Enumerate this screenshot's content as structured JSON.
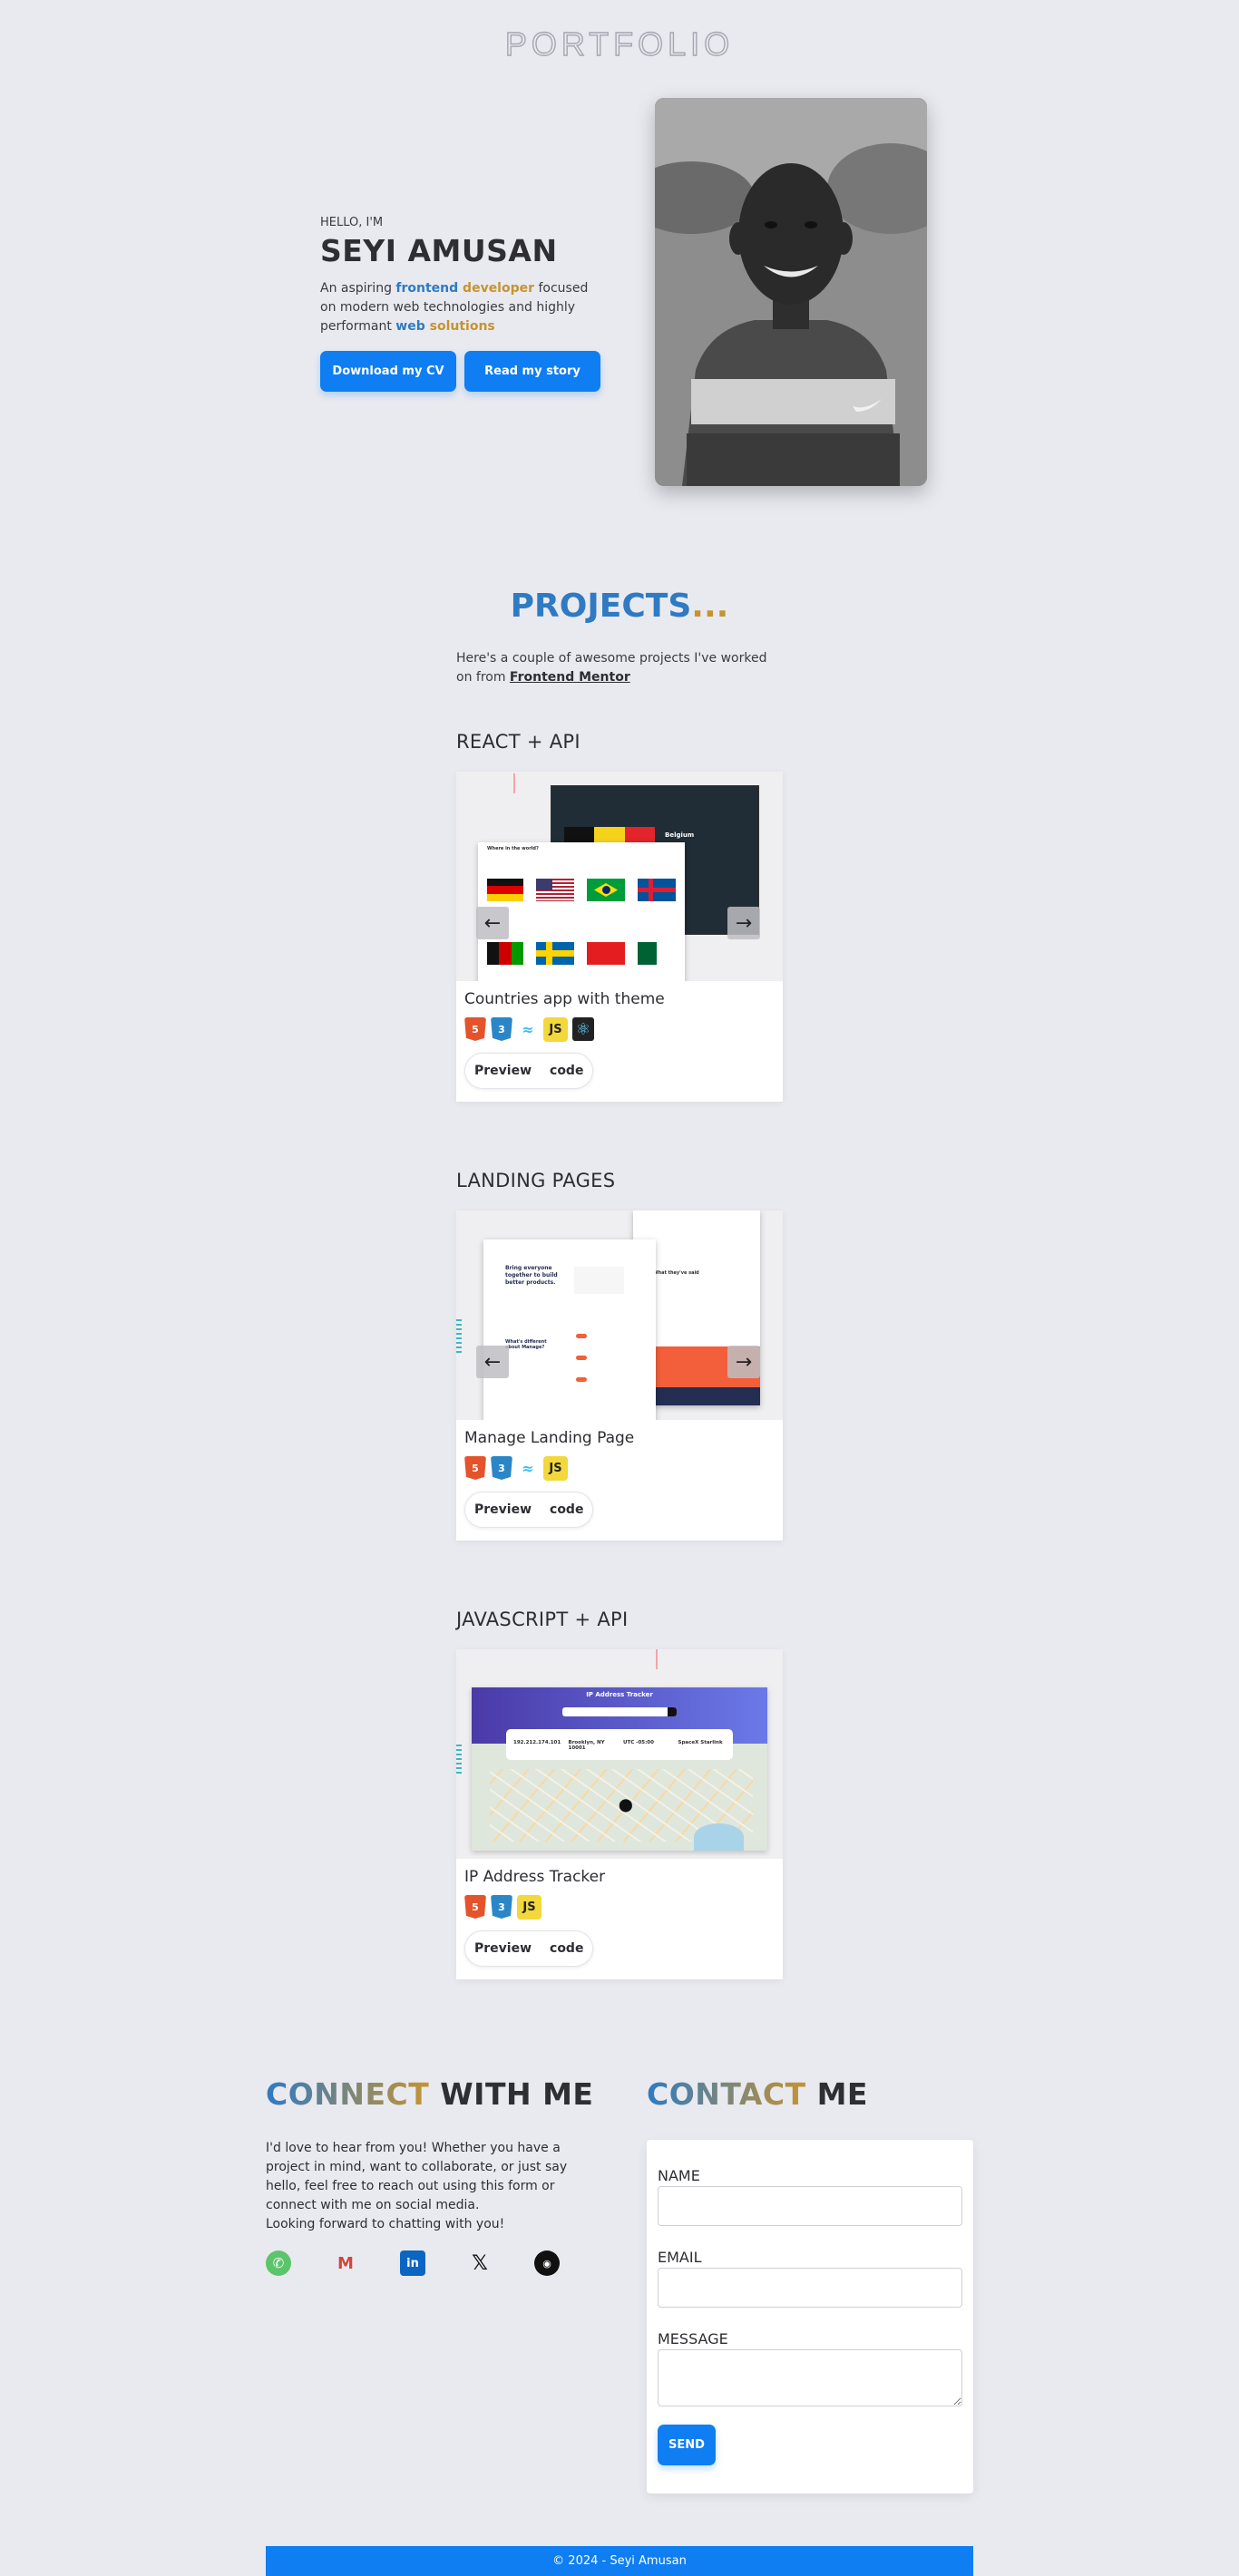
{
  "brand": "PORTFOLIO",
  "hero": {
    "hello": "HELLO, I'M",
    "name": "SEYI AMUSAN",
    "desc_1": "An aspiring ",
    "desc_hl1_a": "frontend",
    "desc_hl1_b": " developer",
    "desc_2": " focused on modern web technologies and highly performant ",
    "desc_hl2_a": "web",
    "desc_hl2_b": " solutions",
    "btn_cv": "Download my CV",
    "btn_story": "Read my story"
  },
  "projects": {
    "title_a": "PROJECTS",
    "title_b": "...",
    "intro": "Here's a couple of awesome projects I've worked on from ",
    "intro_link": "Frontend Mentor",
    "groups": [
      {
        "category": "REACT + API",
        "title": "Countries app with theme",
        "tech": [
          "html5-icon",
          "css3-icon",
          "tailwind-icon",
          "javascript-icon",
          "react-icon"
        ],
        "preview_label": "Preview",
        "code_label": "code"
      },
      {
        "category": "LANDING PAGES",
        "title": "Manage Landing Page",
        "tech": [
          "html5-icon",
          "css3-icon",
          "tailwind-icon",
          "javascript-icon"
        ],
        "preview_label": "Preview",
        "code_label": "code"
      },
      {
        "category": "JAVASCRIPT + API",
        "title": "IP Address Tracker",
        "tech": [
          "html5-icon",
          "css3-icon",
          "javascript-icon"
        ],
        "preview_label": "Preview",
        "code_label": "code"
      }
    ],
    "mock": {
      "countries_header": "Where in the world?",
      "country_detail": "Belgium",
      "manage_headline": "Bring everyone together to build better products.",
      "manage_section": "What's different about Manage?",
      "manage_quote": "What they've said",
      "ip_title": "IP Address Tracker",
      "ip_values": [
        "192.212.174.101",
        "Brooklyn, NY 10001",
        "UTC -05:00",
        "SpaceX Starlink"
      ]
    }
  },
  "connect": {
    "title_a": "CONNECT",
    "title_b": " WITH ME",
    "text": "I'd love to hear from you! Whether you have a project in mind, want to collaborate, or just say hello, feel free to reach out using this form or connect with me on social media.",
    "text_2": "Looking forward to chatting with you!",
    "social": [
      "whatsapp-icon",
      "gmail-icon",
      "linkedin-icon",
      "x-icon",
      "github-icon"
    ]
  },
  "contact": {
    "title_a": "CONTACT",
    "title_b": " ME",
    "name_label": "NAME",
    "email_label": "EMAIL",
    "message_label": "MESSAGE",
    "send_label": "SEND"
  },
  "footer": "© 2024 - Seyi Amusan",
  "colors": {
    "accent": "#0e7ef2",
    "blue_text": "#2f7ac2",
    "gold_text": "#c59332",
    "background": "#e9eaf0"
  }
}
